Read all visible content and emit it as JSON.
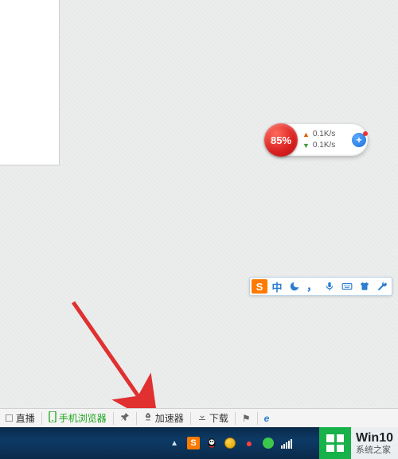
{
  "net_widget": {
    "percent": "85%",
    "upload_speed": "0.1K/s",
    "download_speed": "0.1K/s",
    "plus_label": "+"
  },
  "ime": {
    "logo": "S",
    "mode": "中",
    "icons": [
      "moon",
      "comma",
      "mic",
      "keyboard",
      "shirt",
      "wrench"
    ]
  },
  "status_bar": {
    "live": "直播",
    "mobile_browser": "手机浏览器",
    "accelerator": "加速器",
    "download": "下载"
  },
  "watermark": {
    "title": "Win10",
    "subtitle": "系统之家"
  },
  "colors": {
    "accent_green": "#1aa51a",
    "arrow_red": "#e03030",
    "ime_blue": "#2d7dcf",
    "sogou_orange": "#ff7a00"
  }
}
